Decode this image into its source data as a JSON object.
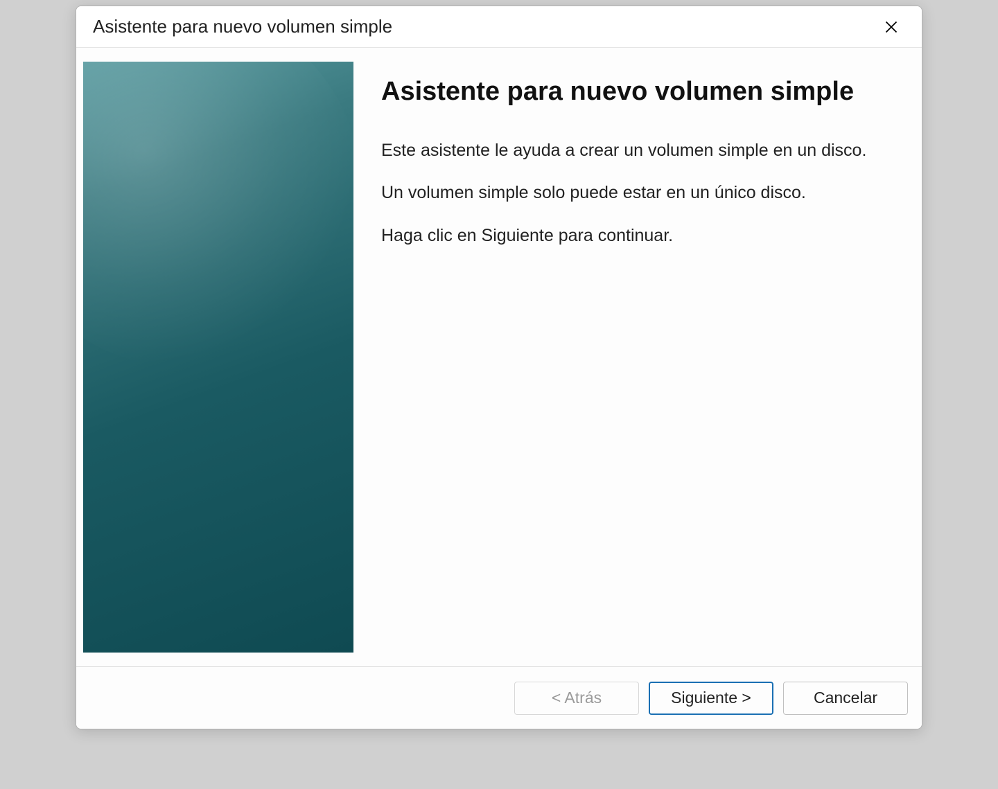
{
  "window": {
    "title": "Asistente para nuevo volumen simple"
  },
  "content": {
    "heading": "Asistente para nuevo volumen simple",
    "para1": "Este asistente le ayuda a crear un volumen simple en un disco.",
    "para2": "Un volumen simple solo puede estar en un único disco.",
    "para3": "Haga clic en Siguiente para continuar."
  },
  "footer": {
    "back_label": "< Atrás",
    "next_label": "Siguiente >",
    "cancel_label": "Cancelar"
  }
}
